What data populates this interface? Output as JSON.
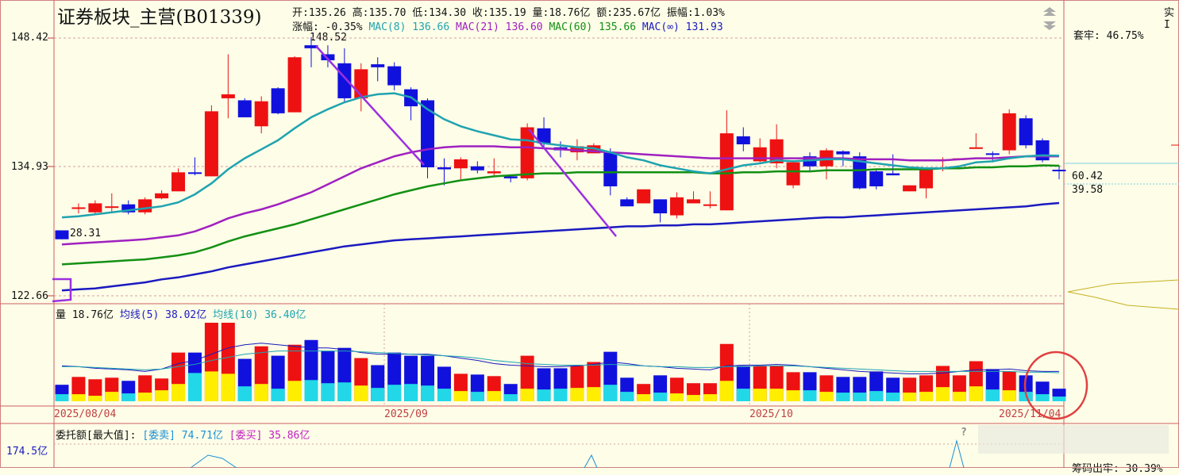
{
  "header": {
    "title": "证券板块_主营(B01339)",
    "ohlc": [
      {
        "label": "开:",
        "value": "135.26"
      },
      {
        "label": "高:",
        "value": "135.70"
      },
      {
        "label": "低:",
        "value": "134.30"
      },
      {
        "label": "收:",
        "value": "135.19"
      },
      {
        "label": "量:",
        "value": "18.76亿"
      },
      {
        "label": "额:",
        "value": "235.67亿"
      },
      {
        "label": "振幅:",
        "value": "1.03%"
      }
    ],
    "ma_legend": [
      {
        "label": "涨幅:",
        "value": "-0.35%",
        "color": "#111111"
      },
      {
        "label": "MAC(8)",
        "value": "136.66",
        "color": "#1fa3b0"
      },
      {
        "label": "MAC(21)",
        "value": "136.60",
        "color": "#a020c0"
      },
      {
        "label": "MAC(60)",
        "value": "135.66",
        "color": "#139013"
      },
      {
        "label": "MAC(∞)",
        "value": "131.93",
        "color": "#1a1ac0"
      }
    ]
  },
  "price_axis": {
    "ticks": [
      "148.42",
      "134.93",
      "122.66"
    ]
  },
  "annotations": {
    "high_label": "148.52",
    "low_label": "28.31"
  },
  "right_panel": {
    "top_label": "实I",
    "ratio_label": "套牢: 46.75%",
    "values": [
      "60.42",
      "39.58"
    ],
    "bottom_label": "筹码出牢: 30.39%"
  },
  "volume": {
    "legend": [
      {
        "label": "量",
        "value": "18.76亿",
        "color": "#111111"
      },
      {
        "label": "均线(5)",
        "value": "38.02亿",
        "color": "#1a1ac0"
      },
      {
        "label": "均线(10)",
        "value": "36.40亿",
        "color": "#1fa3b0"
      }
    ]
  },
  "x_axis": {
    "labels": [
      "2025/08/04",
      "2025/09",
      "2025/10",
      "2025/11/04"
    ]
  },
  "entrust": {
    "legend": [
      {
        "label": "委托额[最大值]:",
        "value": "",
        "color": "#111111"
      },
      {
        "label": "[委卖]",
        "value": "74.71亿",
        "color": "#1a8fd6"
      },
      {
        "label": "[委买]",
        "value": "35.86亿",
        "color": "#c020c0"
      }
    ],
    "axis_label": "174.5亿",
    "question_mark": "?"
  },
  "colors": {
    "up": "#ee1111",
    "down": "#1111dd",
    "background": "#fdfde8",
    "grid": "#c04040"
  },
  "chart_data": {
    "type": "candlestick",
    "price_ylim": [
      122.66,
      148.42
    ],
    "candles": [
      {
        "o": 129.2,
        "c": 128.31,
        "h": 129.2,
        "l": 128.31
      },
      {
        "o": 131.4,
        "c": 131.5,
        "h": 131.9,
        "l": 130.9
      },
      {
        "o": 131.0,
        "c": 131.9,
        "h": 132.2,
        "l": 130.9
      },
      {
        "o": 131.6,
        "c": 131.6,
        "h": 132.9,
        "l": 131.0
      },
      {
        "o": 131.8,
        "c": 131.0,
        "h": 132.2,
        "l": 130.8
      },
      {
        "o": 131.0,
        "c": 132.3,
        "h": 132.5,
        "l": 130.8
      },
      {
        "o": 132.4,
        "c": 132.9,
        "h": 133.2,
        "l": 132.3
      },
      {
        "o": 133.1,
        "c": 135.0,
        "h": 135.4,
        "l": 133.1
      },
      {
        "o": 135.0,
        "c": 134.9,
        "h": 136.5,
        "l": 134.7
      },
      {
        "o": 134.6,
        "c": 141.1,
        "h": 141.7,
        "l": 134.6
      },
      {
        "o": 142.4,
        "c": 142.8,
        "h": 146.8,
        "l": 140.4
      },
      {
        "o": 142.2,
        "c": 140.5,
        "h": 142.4,
        "l": 140.5
      },
      {
        "o": 139.6,
        "c": 142.1,
        "h": 142.6,
        "l": 138.9
      },
      {
        "o": 143.4,
        "c": 140.9,
        "h": 143.5,
        "l": 140.8
      },
      {
        "o": 141.0,
        "c": 146.5,
        "h": 146.6,
        "l": 141.0
      },
      {
        "o": 147.7,
        "c": 147.4,
        "h": 148.52,
        "l": 145.5
      },
      {
        "o": 146.8,
        "c": 146.2,
        "h": 147.7,
        "l": 145.5
      },
      {
        "o": 145.9,
        "c": 142.4,
        "h": 147.4,
        "l": 142.0
      },
      {
        "o": 142.4,
        "c": 145.3,
        "h": 145.9,
        "l": 141.1
      },
      {
        "o": 145.8,
        "c": 145.5,
        "h": 146.5,
        "l": 144.1
      },
      {
        "o": 145.6,
        "c": 143.7,
        "h": 146.0,
        "l": 143.2
      },
      {
        "o": 143.3,
        "c": 141.6,
        "h": 143.5,
        "l": 140.2
      },
      {
        "o": 142.2,
        "c": 135.5,
        "h": 142.4,
        "l": 134.4
      },
      {
        "o": 135.5,
        "c": 135.3,
        "h": 136.4,
        "l": 133.7
      },
      {
        "o": 135.4,
        "c": 136.3,
        "h": 136.5,
        "l": 134.3
      },
      {
        "o": 135.6,
        "c": 135.2,
        "h": 136.1,
        "l": 134.9
      },
      {
        "o": 134.9,
        "c": 135.1,
        "h": 136.4,
        "l": 134.5
      },
      {
        "o": 134.6,
        "c": 134.4,
        "h": 134.8,
        "l": 134.0
      },
      {
        "o": 134.4,
        "c": 139.5,
        "h": 139.9,
        "l": 134.2
      },
      {
        "o": 139.4,
        "c": 137.9,
        "h": 140.5,
        "l": 137.4
      },
      {
        "o": 137.5,
        "c": 137.2,
        "h": 138.1,
        "l": 136.5
      },
      {
        "o": 137.0,
        "c": 137.6,
        "h": 138.3,
        "l": 136.2
      },
      {
        "o": 136.9,
        "c": 137.7,
        "h": 137.9,
        "l": 136.9
      },
      {
        "o": 137.0,
        "c": 133.6,
        "h": 137.4,
        "l": 132.7
      },
      {
        "o": 132.3,
        "c": 131.6,
        "h": 132.5,
        "l": 131.6
      },
      {
        "o": 131.9,
        "c": 133.3,
        "h": 133.3,
        "l": 131.9
      },
      {
        "o": 132.3,
        "c": 130.9,
        "h": 132.3,
        "l": 130.0
      },
      {
        "o": 130.7,
        "c": 132.5,
        "h": 133.0,
        "l": 130.4
      },
      {
        "o": 131.9,
        "c": 132.3,
        "h": 133.1,
        "l": 131.9
      },
      {
        "o": 131.7,
        "c": 131.8,
        "h": 133.1,
        "l": 131.4
      },
      {
        "o": 131.2,
        "c": 138.9,
        "h": 141.2,
        "l": 131.2
      },
      {
        "o": 138.6,
        "c": 137.8,
        "h": 139.5,
        "l": 137.1
      },
      {
        "o": 136.1,
        "c": 137.5,
        "h": 138.4,
        "l": 136.0
      },
      {
        "o": 135.9,
        "c": 138.3,
        "h": 139.8,
        "l": 135.4
      },
      {
        "o": 133.7,
        "c": 136.0,
        "h": 136.2,
        "l": 133.4
      },
      {
        "o": 136.6,
        "c": 135.6,
        "h": 137.0,
        "l": 135.0
      },
      {
        "o": 135.6,
        "c": 137.2,
        "h": 137.4,
        "l": 134.3
      },
      {
        "o": 137.1,
        "c": 136.8,
        "h": 137.2,
        "l": 135.6
      },
      {
        "o": 136.6,
        "c": 133.4,
        "h": 137.0,
        "l": 133.3
      },
      {
        "o": 135.1,
        "c": 133.6,
        "h": 135.3,
        "l": 133.3
      },
      {
        "o": 134.9,
        "c": 134.7,
        "h": 136.8,
        "l": 134.7
      },
      {
        "o": 133.1,
        "c": 133.7,
        "h": 133.7,
        "l": 133.1
      },
      {
        "o": 133.4,
        "c": 135.3,
        "h": 135.3,
        "l": 132.4
      },
      {
        "o": 136.3,
        "c": 136.3,
        "h": 136.5,
        "l": 135.1
      },
      {
        "o": 136.3,
        "c": 136.4,
        "h": 136.4,
        "l": 136.2
      },
      {
        "o": 137.5,
        "c": 137.5,
        "h": 138.9,
        "l": 137.4
      },
      {
        "o": 136.9,
        "c": 136.8,
        "h": 137.1,
        "l": 136.0
      },
      {
        "o": 137.2,
        "c": 140.9,
        "h": 141.3,
        "l": 136.8
      },
      {
        "o": 140.4,
        "c": 137.7,
        "h": 140.7,
        "l": 137.4
      },
      {
        "o": 138.2,
        "c": 136.2,
        "h": 138.4,
        "l": 136.0
      },
      {
        "o": 135.26,
        "c": 135.19,
        "h": 135.7,
        "l": 134.3
      }
    ],
    "volumes": [
      {
        "v": 21,
        "low": 9
      },
      {
        "v": 31,
        "low": 9
      },
      {
        "v": 28,
        "low": 7
      },
      {
        "v": 30,
        "low": 12
      },
      {
        "v": 26,
        "low": 10
      },
      {
        "v": 33,
        "low": 11
      },
      {
        "v": 29,
        "low": 14
      },
      {
        "v": 62,
        "low": 22
      },
      {
        "v": 62,
        "low": 36
      },
      {
        "v": 100,
        "low": 38
      },
      {
        "v": 100,
        "low": 35
      },
      {
        "v": 54,
        "low": 19
      },
      {
        "v": 70,
        "low": 22
      },
      {
        "v": 58,
        "low": 16
      },
      {
        "v": 72,
        "low": 26
      },
      {
        "v": 78,
        "low": 27
      },
      {
        "v": 64,
        "low": 23
      },
      {
        "v": 68,
        "low": 24
      },
      {
        "v": 55,
        "low": 20
      },
      {
        "v": 46,
        "low": 17
      },
      {
        "v": 62,
        "low": 21
      },
      {
        "v": 58,
        "low": 22
      },
      {
        "v": 58,
        "low": 20
      },
      {
        "v": 44,
        "low": 16
      },
      {
        "v": 35,
        "low": 13
      },
      {
        "v": 34,
        "low": 12
      },
      {
        "v": 32,
        "low": 13
      },
      {
        "v": 22,
        "low": 9
      },
      {
        "v": 58,
        "low": 16
      },
      {
        "v": 42,
        "low": 15
      },
      {
        "v": 42,
        "low": 16
      },
      {
        "v": 45,
        "low": 17
      },
      {
        "v": 50,
        "low": 18
      },
      {
        "v": 63,
        "low": 21
      },
      {
        "v": 30,
        "low": 12
      },
      {
        "v": 22,
        "low": 9
      },
      {
        "v": 33,
        "low": 11
      },
      {
        "v": 30,
        "low": 10
      },
      {
        "v": 23,
        "low": 8
      },
      {
        "v": 23,
        "low": 9
      },
      {
        "v": 73,
        "low": 26
      },
      {
        "v": 45,
        "low": 16
      },
      {
        "v": 45,
        "low": 16
      },
      {
        "v": 45,
        "low": 16
      },
      {
        "v": 37,
        "low": 14
      },
      {
        "v": 37,
        "low": 14
      },
      {
        "v": 33,
        "low": 12
      },
      {
        "v": 31,
        "low": 11
      },
      {
        "v": 31,
        "low": 11
      },
      {
        "v": 38,
        "low": 13
      },
      {
        "v": 30,
        "low": 11
      },
      {
        "v": 30,
        "low": 11
      },
      {
        "v": 33,
        "low": 12
      },
      {
        "v": 45,
        "low": 18
      },
      {
        "v": 33,
        "low": 12
      },
      {
        "v": 51,
        "low": 19
      },
      {
        "v": 41,
        "low": 15
      },
      {
        "v": 38,
        "low": 14
      },
      {
        "v": 33,
        "low": 12
      },
      {
        "v": 25,
        "low": 9
      },
      {
        "v": 16,
        "low": 6
      }
    ],
    "ma8": [
      130.5,
      130.6,
      130.8,
      131.0,
      131.2,
      131.4,
      131.6,
      132.0,
      132.8,
      133.9,
      135.3,
      136.4,
      137.3,
      138.2,
      139.4,
      140.5,
      141.3,
      142.0,
      142.5,
      142.8,
      142.9,
      142.5,
      141.3,
      140.3,
      139.6,
      139.1,
      138.7,
      138.3,
      138.2,
      137.9,
      137.7,
      137.5,
      137.4,
      137.0,
      136.5,
      136.2,
      135.7,
      135.4,
      135.1,
      134.9,
      135.3,
      135.7,
      135.9,
      136.2,
      136.1,
      136.2,
      136.3,
      136.3,
      136.1,
      135.9,
      135.7,
      135.5,
      135.4,
      135.4,
      135.6,
      136.0,
      136.1,
      136.4,
      136.6,
      136.7,
      136.66
    ],
    "ma21": [
      127.8,
      127.9,
      128.0,
      128.1,
      128.2,
      128.3,
      128.5,
      128.7,
      129.1,
      129.7,
      130.4,
      130.9,
      131.3,
      131.8,
      132.4,
      133.0,
      133.8,
      134.6,
      135.4,
      136.0,
      136.6,
      137.0,
      137.3,
      137.5,
      137.6,
      137.6,
      137.6,
      137.5,
      137.5,
      137.4,
      137.3,
      137.2,
      137.1,
      137.0,
      136.9,
      136.8,
      136.7,
      136.6,
      136.5,
      136.4,
      136.4,
      136.4,
      136.4,
      136.4,
      136.4,
      136.4,
      136.4,
      136.4,
      136.3,
      136.3,
      136.3,
      136.2,
      136.2,
      136.2,
      136.3,
      136.4,
      136.4,
      136.5,
      136.6,
      136.6,
      136.6
    ],
    "ma60": [
      125.8,
      125.9,
      126.0,
      126.1,
      126.2,
      126.3,
      126.5,
      126.7,
      127.0,
      127.5,
      128.1,
      128.6,
      129.0,
      129.4,
      129.8,
      130.3,
      130.8,
      131.3,
      131.8,
      132.3,
      132.8,
      133.2,
      133.6,
      133.9,
      134.2,
      134.4,
      134.6,
      134.7,
      134.8,
      134.9,
      134.9,
      135.0,
      135.0,
      135.0,
      135.0,
      135.0,
      135.0,
      135.0,
      135.0,
      134.9,
      134.9,
      135.0,
      135.0,
      135.1,
      135.1,
      135.1,
      135.2,
      135.2,
      135.2,
      135.3,
      135.3,
      135.3,
      135.3,
      135.4,
      135.4,
      135.5,
      135.5,
      135.6,
      135.6,
      135.7,
      135.66
    ],
    "mainf": [
      123.2,
      123.3,
      123.4,
      123.6,
      123.8,
      124.0,
      124.3,
      124.5,
      124.8,
      125.1,
      125.5,
      125.8,
      126.1,
      126.4,
      126.7,
      127.0,
      127.3,
      127.6,
      127.8,
      128.0,
      128.2,
      128.3,
      128.4,
      128.5,
      128.6,
      128.7,
      128.8,
      128.9,
      129.0,
      129.1,
      129.2,
      129.3,
      129.4,
      129.5,
      129.6,
      129.6,
      129.7,
      129.7,
      129.8,
      129.8,
      129.9,
      130.0,
      130.1,
      130.2,
      130.3,
      130.4,
      130.5,
      130.5,
      130.6,
      130.7,
      130.8,
      130.9,
      131.0,
      131.1,
      131.2,
      131.3,
      131.4,
      131.5,
      131.6,
      131.8,
      131.93
    ],
    "vol_ma5": [
      45,
      44,
      42,
      41,
      40,
      38,
      41,
      48,
      52,
      60,
      68,
      72,
      74,
      72,
      70,
      68,
      68,
      66,
      62,
      60,
      60,
      60,
      60,
      58,
      55,
      52,
      48,
      46,
      45,
      44,
      44,
      45,
      47,
      50,
      48,
      45,
      44,
      42,
      41,
      40,
      45,
      46,
      46,
      47,
      46,
      44,
      42,
      40,
      38,
      37,
      36,
      35,
      35,
      36,
      38,
      40,
      40,
      41,
      39,
      38,
      38.02
    ],
    "vol_ma10": [
      44,
      44,
      43,
      42,
      41,
      40,
      41,
      44,
      47,
      52,
      56,
      60,
      62,
      64,
      64,
      64,
      64,
      64,
      63,
      62,
      61,
      60,
      59,
      58,
      57,
      55,
      52,
      50,
      48,
      47,
      46,
      46,
      46,
      47,
      46,
      45,
      44,
      44,
      43,
      43,
      44,
      44,
      45,
      45,
      45,
      44,
      43,
      42,
      41,
      40,
      39,
      38,
      38,
      38,
      38,
      38,
      38,
      38,
      37,
      37,
      36.4
    ],
    "date_labels": [
      "2025/08/04",
      "2025/09",
      "2025/10",
      "2025/11/04"
    ]
  }
}
